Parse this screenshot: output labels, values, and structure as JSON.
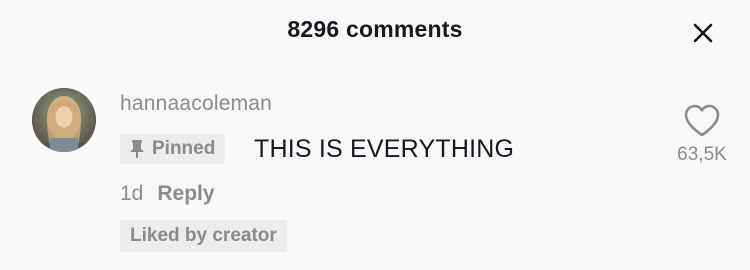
{
  "header": {
    "title": "8296 comments",
    "close_icon": "close-icon"
  },
  "comment": {
    "username": "hannaacoleman",
    "avatar": "avatar",
    "pinned_label": "Pinned",
    "pin_icon": "pin-icon",
    "text": "THIS IS EVERYTHING",
    "timestamp": "1d",
    "reply_label": "Reply",
    "liked_badge": "Liked by creator",
    "like_icon": "heart-icon",
    "like_count": "63,5K"
  },
  "colors": {
    "background": "#f8f8f8",
    "primary_text": "#161823",
    "secondary_text": "#8a8b91",
    "badge_bg": "#ececec"
  }
}
